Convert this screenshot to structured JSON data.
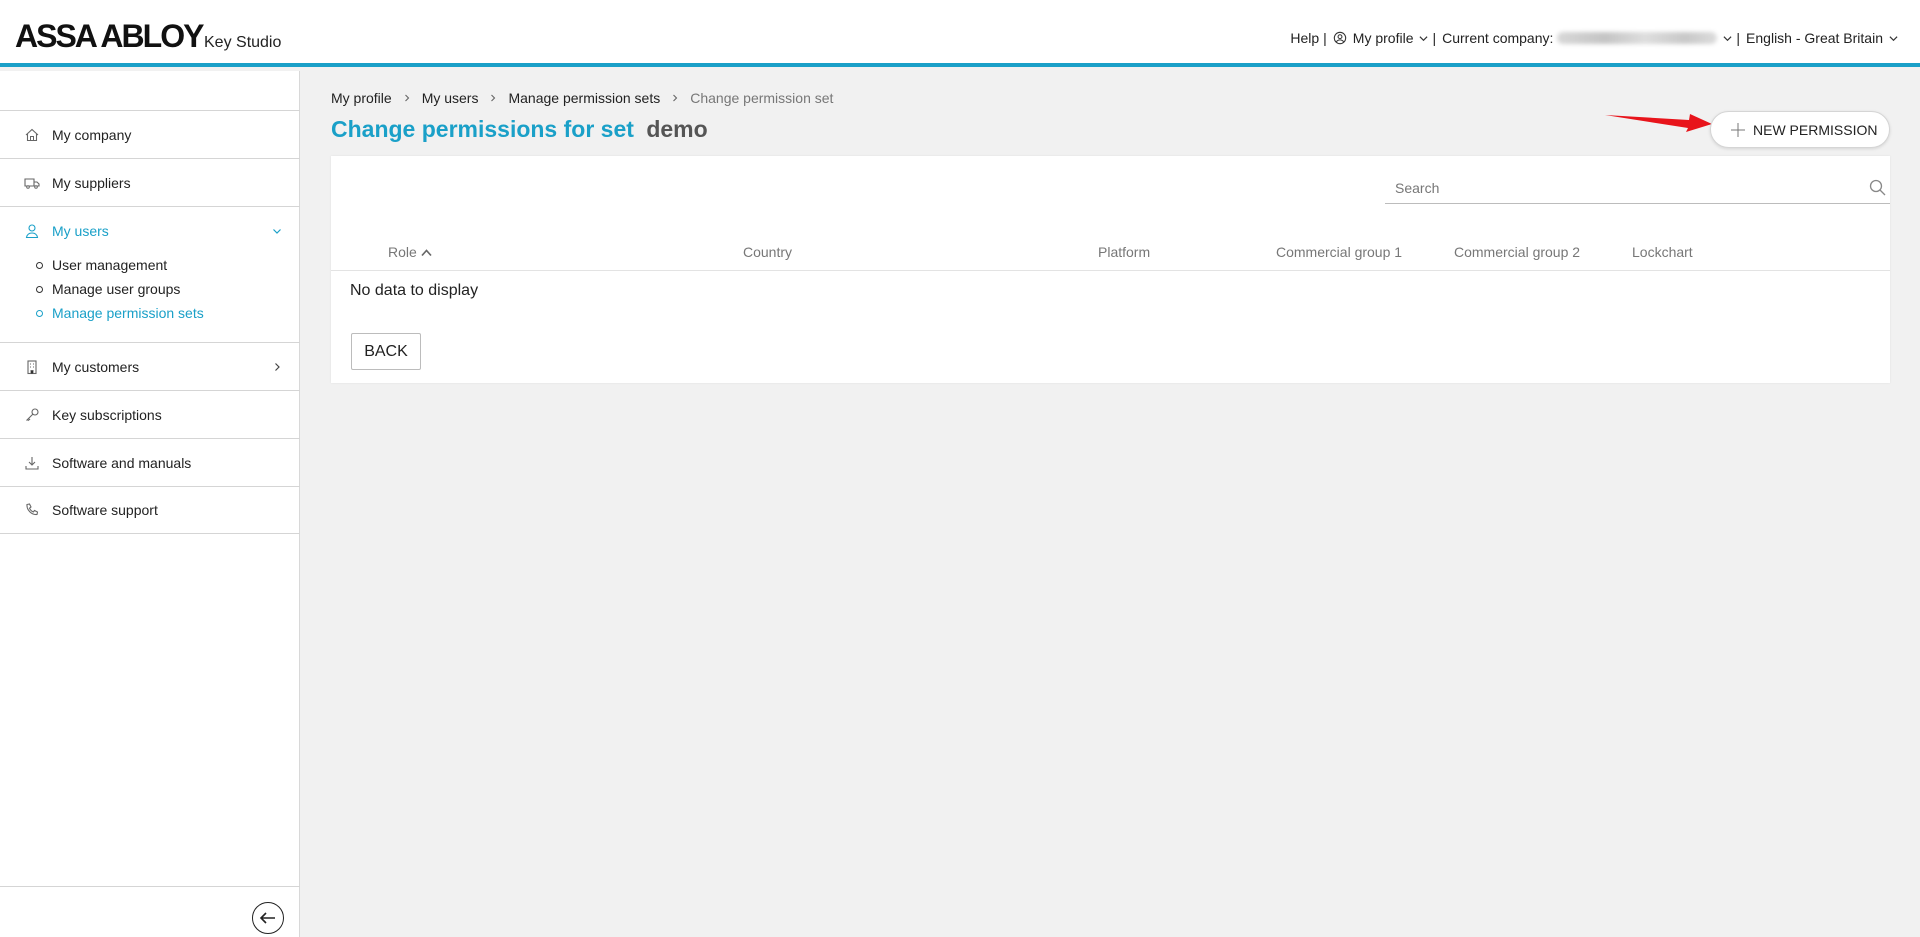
{
  "header": {
    "logo": "ASSA ABLOY",
    "product": "Key Studio",
    "help": "Help",
    "my_profile": "My profile",
    "current_company_label": "Current company:",
    "language": "English - Great Britain",
    "accent_color": "#1aa0c8"
  },
  "sidebar": {
    "items": [
      {
        "label": "My company",
        "icon": "home-icon"
      },
      {
        "label": "My suppliers",
        "icon": "truck-icon"
      },
      {
        "label": "My users",
        "icon": "user-icon"
      },
      {
        "label": "My customers",
        "icon": "building-icon"
      },
      {
        "label": "Key subscriptions",
        "icon": "key-icon"
      },
      {
        "label": "Software and manuals",
        "icon": "download-icon"
      },
      {
        "label": "Software support",
        "icon": "phone-icon"
      }
    ],
    "sub_items": [
      "User management",
      "Manage user groups",
      "Manage permission sets"
    ]
  },
  "breadcrumb": [
    "My profile",
    "My users",
    "Manage permission sets",
    "Change permission set"
  ],
  "title": {
    "prefix": "Change permissions for set",
    "set_name": "demo"
  },
  "new_permission_button": "NEW PERMISSION",
  "search": {
    "placeholder": "Search"
  },
  "table": {
    "columns": [
      "Role",
      "Country",
      "Platform",
      "Commercial group 1",
      "Commercial group 2",
      "Lockchart"
    ],
    "empty_message": "No data to display"
  },
  "back_button": "BACK"
}
